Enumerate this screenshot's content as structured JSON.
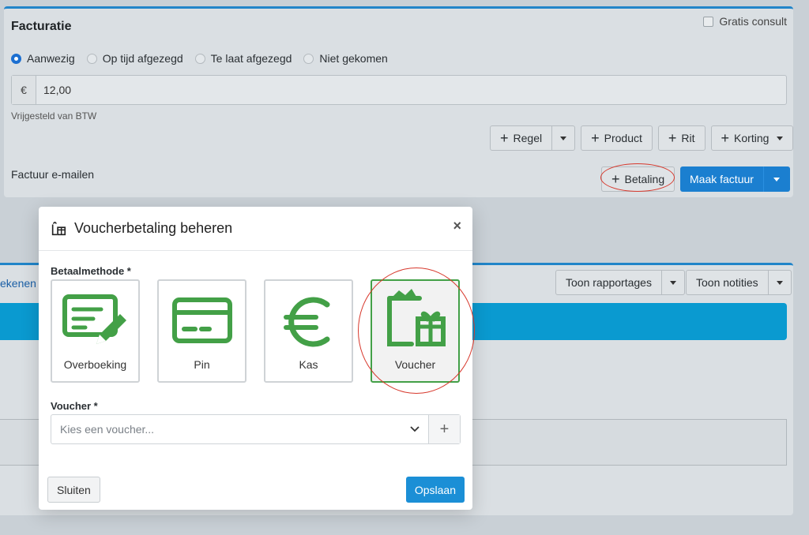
{
  "invoice": {
    "title": "Facturatie",
    "gratis_consult": "Gratis consult",
    "attendance_options": [
      {
        "label": "Aanwezig",
        "selected": true
      },
      {
        "label": "Op tijd afgezegd",
        "selected": false
      },
      {
        "label": "Te laat afgezegd",
        "selected": false
      },
      {
        "label": "Niet gekomen",
        "selected": false
      }
    ],
    "currency_symbol": "€",
    "amount": "12,00",
    "vat_note": "Vrijgesteld van BTW",
    "add_buttons": {
      "regel": "Regel",
      "product": "Product",
      "rit": "Rit",
      "korting": "Korting"
    },
    "email_label": "Factuur e-mailen",
    "betaling": "Betaling",
    "maak_factuur": "Maak factuur"
  },
  "lower_panel": {
    "partial_link": "ekenen",
    "toon_rapportages": "Toon rapportages",
    "toon_notities": "Toon notities"
  },
  "modal": {
    "title": "Voucherbetaling beheren",
    "close_symbol": "×",
    "payment_method_label": "Betaalmethode *",
    "methods": [
      {
        "label": "Overboeking",
        "icon": "bank-transfer-icon",
        "selected": false
      },
      {
        "label": "Pin",
        "icon": "credit-card-icon",
        "selected": false
      },
      {
        "label": "Kas",
        "icon": "euro-icon",
        "selected": false
      },
      {
        "label": "Voucher",
        "icon": "gift-voucher-icon",
        "selected": true
      }
    ],
    "voucher_label": "Voucher *",
    "voucher_placeholder": "Kies een voucher...",
    "add_symbol": "+",
    "close_button": "Sluiten",
    "save_button": "Opslaan"
  },
  "colors": {
    "accent_blue": "#1b7fd0",
    "icon_green": "#43a047",
    "highlight_red": "#d7382c",
    "banner_blue": "#0a9ad0"
  }
}
